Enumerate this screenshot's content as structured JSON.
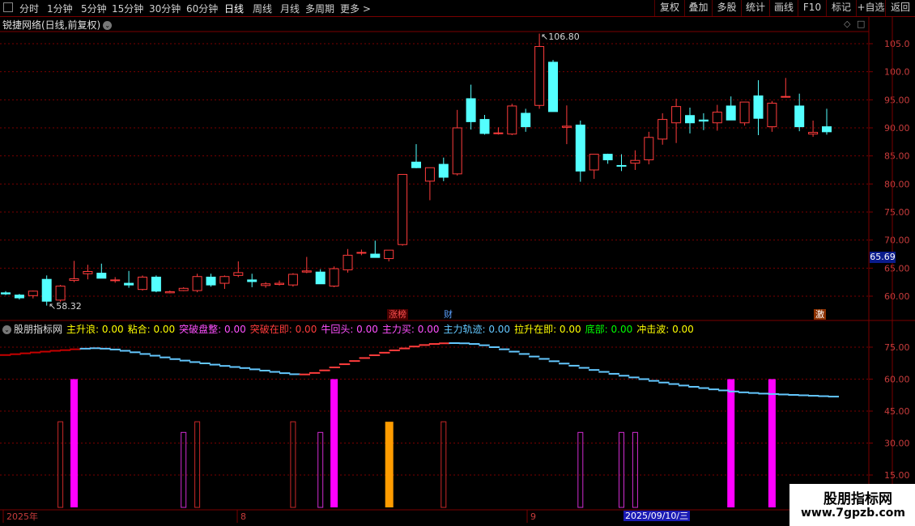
{
  "toolbar": {
    "timeframes": [
      "分时",
      "1分钟",
      "5分钟",
      "15分钟",
      "30分钟",
      "60分钟",
      "日线",
      "周线",
      "月线",
      "多周期",
      "更多 >"
    ],
    "active_timeframe": "日线",
    "right_buttons": [
      "复权",
      "叠加",
      "多股",
      "统计",
      "画线",
      "F10",
      "标记",
      "+自选",
      "返回"
    ]
  },
  "stock": {
    "title": "锐捷网络(日线,前复权)"
  },
  "price_axis": {
    "ticks": [
      "105.0",
      "100.0",
      "95.00",
      "90.00",
      "85.00",
      "80.00",
      "75.00",
      "70.00",
      "65.00",
      "60.00"
    ],
    "current_price": "65.69"
  },
  "annotations": {
    "high": "106.80",
    "low": "58.32"
  },
  "event_tags": [
    {
      "text": "涨榜",
      "color": "#ff5050",
      "bg": "#4a0000"
    },
    {
      "text": "财",
      "color": "#5aa0ff",
      "bg": "#000000"
    },
    {
      "text": "激",
      "color": "#ffffff",
      "bg": "#8a3000"
    }
  ],
  "indicator": {
    "name": "股朋指标网",
    "fields": [
      {
        "label": "主升浪: 0.00",
        "color": "#ffff00"
      },
      {
        "label": "粘合: 0.00",
        "color": "#ffff00"
      },
      {
        "label": "突破盘整: 0.00",
        "color": "#ff50ff"
      },
      {
        "label": "突破在即: 0.00",
        "color": "#ff3c3c"
      },
      {
        "label": "牛回头: 0.00",
        "color": "#ff50ff"
      },
      {
        "label": "主力买: 0.00",
        "color": "#ff50ff"
      },
      {
        "label": "主力轨迹: 0.00",
        "color": "#64c8ff"
      },
      {
        "label": "拉升在即: 0.00",
        "color": "#ffff00"
      },
      {
        "label": "底部: 0.00",
        "color": "#00ff00"
      },
      {
        "label": "冲击波: 0.00",
        "color": "#ffff00"
      }
    ],
    "axis_ticks": [
      "75.00",
      "60.00",
      "45.00",
      "30.00",
      "15.00"
    ]
  },
  "date_axis": {
    "labels": [
      "2025年",
      "8",
      "9"
    ],
    "selected": "2025/09/10/三"
  },
  "watermark": {
    "line1": "股朋指标网",
    "line2": "www.7gpzb.com"
  },
  "colors": {
    "up": "#ff3c3c",
    "down": "#54ffff",
    "grid": "#7a0000",
    "magenta": "#ff00ff",
    "orange": "#ff9c00"
  },
  "chart_data": {
    "type": "candlestick",
    "ohlc": [
      [
        60.6,
        60.9,
        60.2,
        60.4
      ],
      [
        60.2,
        60.4,
        59.4,
        59.7
      ],
      [
        60.1,
        61.0,
        59.6,
        60.9
      ],
      [
        63.0,
        63.7,
        58.32,
        59.1
      ],
      [
        59.3,
        62.0,
        59.0,
        61.8
      ],
      [
        62.8,
        66.3,
        62.5,
        63.1
      ],
      [
        64.0,
        65.6,
        63.0,
        64.4
      ],
      [
        64.1,
        65.8,
        63.4,
        63.2
      ],
      [
        62.9,
        63.4,
        62.4,
        62.9
      ],
      [
        62.3,
        64.5,
        61.5,
        62.0
      ],
      [
        61.2,
        63.7,
        61.0,
        63.4
      ],
      [
        63.4,
        63.7,
        60.7,
        60.9
      ],
      [
        60.6,
        61.0,
        60.5,
        60.8
      ],
      [
        61.0,
        61.6,
        60.9,
        61.4
      ],
      [
        61.0,
        64.0,
        60.7,
        63.5
      ],
      [
        63.4,
        64.0,
        61.7,
        62.0
      ],
      [
        62.3,
        63.7,
        61.3,
        63.5
      ],
      [
        63.7,
        66.2,
        63.4,
        64.2
      ],
      [
        62.9,
        64.0,
        61.6,
        62.6
      ],
      [
        61.9,
        62.5,
        61.5,
        62.2
      ],
      [
        62.1,
        62.8,
        61.9,
        62.3
      ],
      [
        62.0,
        64.1,
        61.7,
        63.9
      ],
      [
        64.3,
        67.0,
        64.1,
        64.5
      ],
      [
        64.3,
        64.8,
        62.2,
        62.2
      ],
      [
        61.8,
        65.3,
        61.6,
        64.9
      ],
      [
        64.7,
        68.4,
        64.2,
        67.3
      ],
      [
        67.7,
        68.3,
        67.3,
        67.8
      ],
      [
        67.5,
        69.9,
        67.3,
        66.9
      ],
      [
        66.7,
        68.2,
        66.2,
        68.2
      ],
      [
        69.2,
        80.4,
        69.0,
        81.7
      ],
      [
        83.9,
        87.1,
        82.8,
        82.9
      ],
      [
        80.5,
        82.9,
        77.1,
        82.9
      ],
      [
        83.5,
        84.7,
        80.5,
        81.2
      ],
      [
        81.8,
        93.2,
        81.5,
        90.0
      ],
      [
        95.2,
        97.7,
        89.7,
        91.1
      ],
      [
        91.5,
        92.3,
        88.8,
        89.0
      ],
      [
        89.1,
        90.1,
        88.8,
        89.1
      ],
      [
        88.9,
        94.3,
        88.7,
        93.9
      ],
      [
        92.6,
        93.4,
        89.3,
        90.2
      ],
      [
        94.0,
        106.8,
        93.4,
        104.5
      ],
      [
        101.7,
        102.1,
        92.9,
        92.9
      ],
      [
        90.1,
        94.0,
        87.1,
        90.3
      ],
      [
        90.5,
        91.3,
        80.4,
        82.3
      ],
      [
        82.5,
        85.2,
        80.9,
        85.3
      ],
      [
        85.3,
        85.4,
        83.6,
        84.3
      ],
      [
        83.3,
        85.3,
        82.3,
        83.2
      ],
      [
        83.7,
        86.0,
        82.5,
        84.2
      ],
      [
        84.3,
        89.3,
        83.5,
        88.3
      ],
      [
        88.0,
        92.6,
        87.0,
        91.5
      ],
      [
        90.9,
        95.2,
        87.3,
        93.8
      ],
      [
        92.2,
        93.6,
        89.0,
        90.9
      ],
      [
        91.4,
        92.6,
        89.6,
        91.2
      ],
      [
        90.9,
        94.1,
        89.5,
        92.8
      ],
      [
        93.9,
        95.6,
        92.9,
        91.4
      ],
      [
        90.9,
        94.6,
        90.4,
        94.6
      ],
      [
        95.7,
        98.5,
        88.7,
        91.7
      ],
      [
        90.2,
        94.8,
        89.3,
        94.4
      ],
      [
        95.6,
        98.9,
        95.4,
        95.6
      ],
      [
        93.9,
        96.1,
        89.4,
        90.2
      ],
      [
        88.9,
        91.3,
        88.4,
        89.2
      ],
      [
        90.2,
        93.4,
        88.8,
        89.3
      ]
    ],
    "indicator_series": {
      "line": [
        71.3,
        71.7,
        72.1,
        72.5,
        72.9,
        73.3,
        73.6,
        74.0,
        74.3,
        74.5,
        74.3,
        73.9,
        73.3,
        72.6,
        71.8,
        71.0,
        70.2,
        69.4,
        68.7,
        68.0,
        67.4,
        66.8,
        66.2,
        65.7,
        65.2,
        64.6,
        64.0,
        63.4,
        62.8,
        62.3,
        62.2,
        62.9,
        64.1,
        65.5,
        67.0,
        68.5,
        69.9,
        71.2,
        72.4,
        73.5,
        74.4,
        75.3,
        76.0,
        76.5,
        76.8,
        76.9,
        76.8,
        76.5,
        75.9,
        75.0,
        74.0,
        72.9,
        71.8,
        70.6,
        69.5,
        68.4,
        67.3,
        66.3,
        65.3,
        64.3,
        63.4,
        62.5,
        61.6,
        60.8,
        60.0,
        59.2,
        58.4,
        57.7,
        57.0,
        56.4,
        55.8,
        55.2,
        54.7,
        54.2,
        53.8,
        53.5,
        53.2,
        53.0,
        52.8,
        52.6,
        52.4,
        52.2,
        52.0,
        51.8
      ],
      "color_switch_index": 52,
      "line_colors": [
        "#c80000",
        "#ff3c3c",
        "#64c8ff"
      ],
      "magenta_filled": [
        5,
        24,
        53,
        56
      ],
      "orange_filled": [
        28
      ],
      "red_hollow": [
        4,
        14,
        21,
        32
      ],
      "magenta_hollow": [
        13,
        23,
        42,
        45,
        46
      ]
    }
  }
}
